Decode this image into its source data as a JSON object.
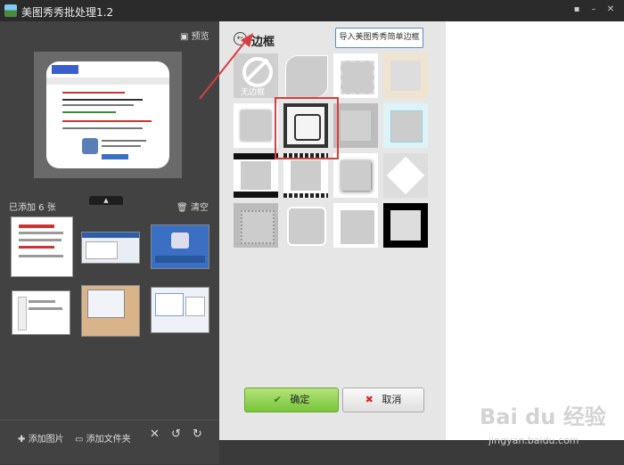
{
  "window": {
    "title": "美图秀秀批处理1.2"
  },
  "left_panel": {
    "preview_label": "预览",
    "added_label": "已添加 6 张",
    "clear_label": "清空",
    "thumbnail_count": 6,
    "bottom_actions": {
      "add_image": "添加图片",
      "add_folder": "添加文件夹"
    }
  },
  "dialog": {
    "title": "边框",
    "import_button": "导入美图秀秀简单边框",
    "no_frame_label": "无边框",
    "ok_button": "确定",
    "cancel_button": "取消"
  },
  "watermark": {
    "logo_text": "Bai du 经验",
    "url": "jingyan.baidu.com"
  },
  "colors": {
    "highlight": "#d64040",
    "ok_green": "#78c53a",
    "cancel_red": "#d12a2a"
  }
}
